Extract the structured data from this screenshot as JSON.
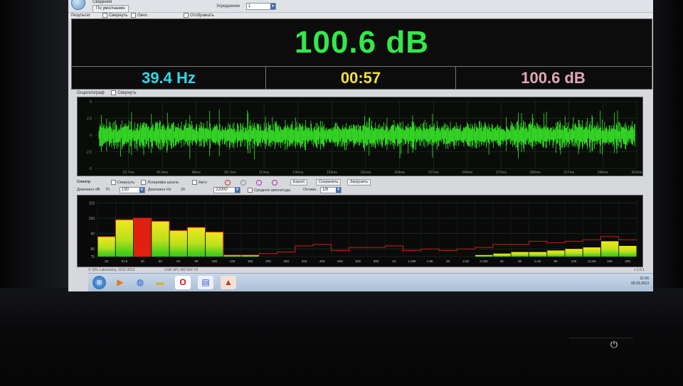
{
  "toolbar": {
    "group_label": "Сведения",
    "default_button": "По умолчанию",
    "averaging_label": "Усреднение",
    "averaging_value": "1"
  },
  "result": {
    "section_label": "Результат",
    "collapse_label": "Свернуть",
    "window_label": "Окно",
    "display_label": "Отображать",
    "level": "100.6 dB",
    "frequency": "39.4 Hz",
    "elapsed": "00:57",
    "peak": "100.6 dB"
  },
  "oscilloscope": {
    "section_label": "Осциллограф",
    "collapse_label": "Свернуть",
    "y_ticks": [
      "5",
      "2.5",
      "0",
      "-2.5",
      "-5"
    ],
    "x_ticks": [
      "22.7ms",
      "45.4ms",
      "68ms",
      "90.7ms",
      "113ms",
      "136ms",
      "159ms",
      "181ms",
      "204ms",
      "227ms",
      "249ms",
      "272ms",
      "295ms",
      "317ms",
      "340ms",
      "363ms"
    ]
  },
  "spectrum_controls": {
    "section_label": "Спектр",
    "collapse_label": "Свернуть",
    "log_scale_label": "Логарифм.шкала",
    "auto_label": "Авто",
    "range_db_label": "Диапазон dB",
    "range_db_min": "70",
    "range_db_max": "150",
    "range_hz_label": "Диапазон Hz",
    "range_hz_min": "20",
    "range_hz_max": "22000",
    "avg_amp_label": "Средняя амплитуда",
    "octave_label": "Октава",
    "octave_value": "1/6",
    "export_label": "Export",
    "save_label": "Сохранить",
    "load_label": "Загрузить"
  },
  "spectrum": {
    "y_ticks": [
      "110",
      "100",
      "90",
      "80",
      "75"
    ],
    "x_ticks": [
      "25",
      "31.5",
      "40",
      "50",
      "63",
      "80",
      "100",
      "125",
      "160",
      "200",
      "250",
      "315",
      "400",
      "500",
      "630",
      "800",
      "1K",
      "1.25K",
      "1.6K",
      "2K",
      "2.5K",
      "3.15K",
      "4K",
      "5K",
      "6.3K",
      "8K",
      "10K",
      "12.5K",
      "16K",
      "20K"
    ]
  },
  "chart_data": {
    "type": "bar",
    "categories": [
      "25",
      "31.5",
      "40",
      "50",
      "63",
      "80",
      "100",
      "125",
      "160",
      "200",
      "250",
      "315",
      "400",
      "500",
      "630",
      "800",
      "1K",
      "1.25K",
      "1.6K",
      "2K",
      "2.5K",
      "3.15K",
      "4K",
      "5K",
      "6.3K",
      "8K",
      "10K",
      "12.5K",
      "16K",
      "20K"
    ],
    "series": [
      {
        "values": [
          88,
          99,
          100,
          98,
          92,
          94,
          91,
          76,
          76,
          75,
          75,
          75,
          75,
          75,
          75,
          75,
          75,
          75,
          75,
          75,
          75,
          76,
          77,
          78,
          78,
          79,
          80,
          81,
          85,
          82
        ]
      }
    ],
    "peak_values": [
      88,
      99,
      100,
      98,
      92,
      94,
      91,
      76,
      76,
      77,
      78,
      82,
      83,
      79,
      81,
      81,
      82,
      79,
      80,
      79,
      80,
      81,
      83,
      83,
      85,
      84,
      85,
      86,
      88,
      86
    ],
    "highlight_category": "40",
    "ylim": [
      75,
      112
    ]
  },
  "status": {
    "copyright": "© SPL Laboratory, 2011-2013",
    "app_name": "USB SPL METER V2",
    "version": "v 2.6.1"
  },
  "taskbar": {
    "icons": [
      "windows-start-icon",
      "media-player-icon",
      "browser-icon",
      "folder-icon",
      "opera-icon",
      "spl-meter-icon",
      "paint-icon"
    ],
    "tray_time": "21:56",
    "tray_date": "05.03.2013"
  },
  "colors": {
    "level": "#34e84a",
    "frequency": "#2fd8e6",
    "elapsed": "#f0e23c",
    "peak": "#e0a8b6",
    "highlight_bar": "#e02010",
    "peak_line": "#c8201c"
  }
}
